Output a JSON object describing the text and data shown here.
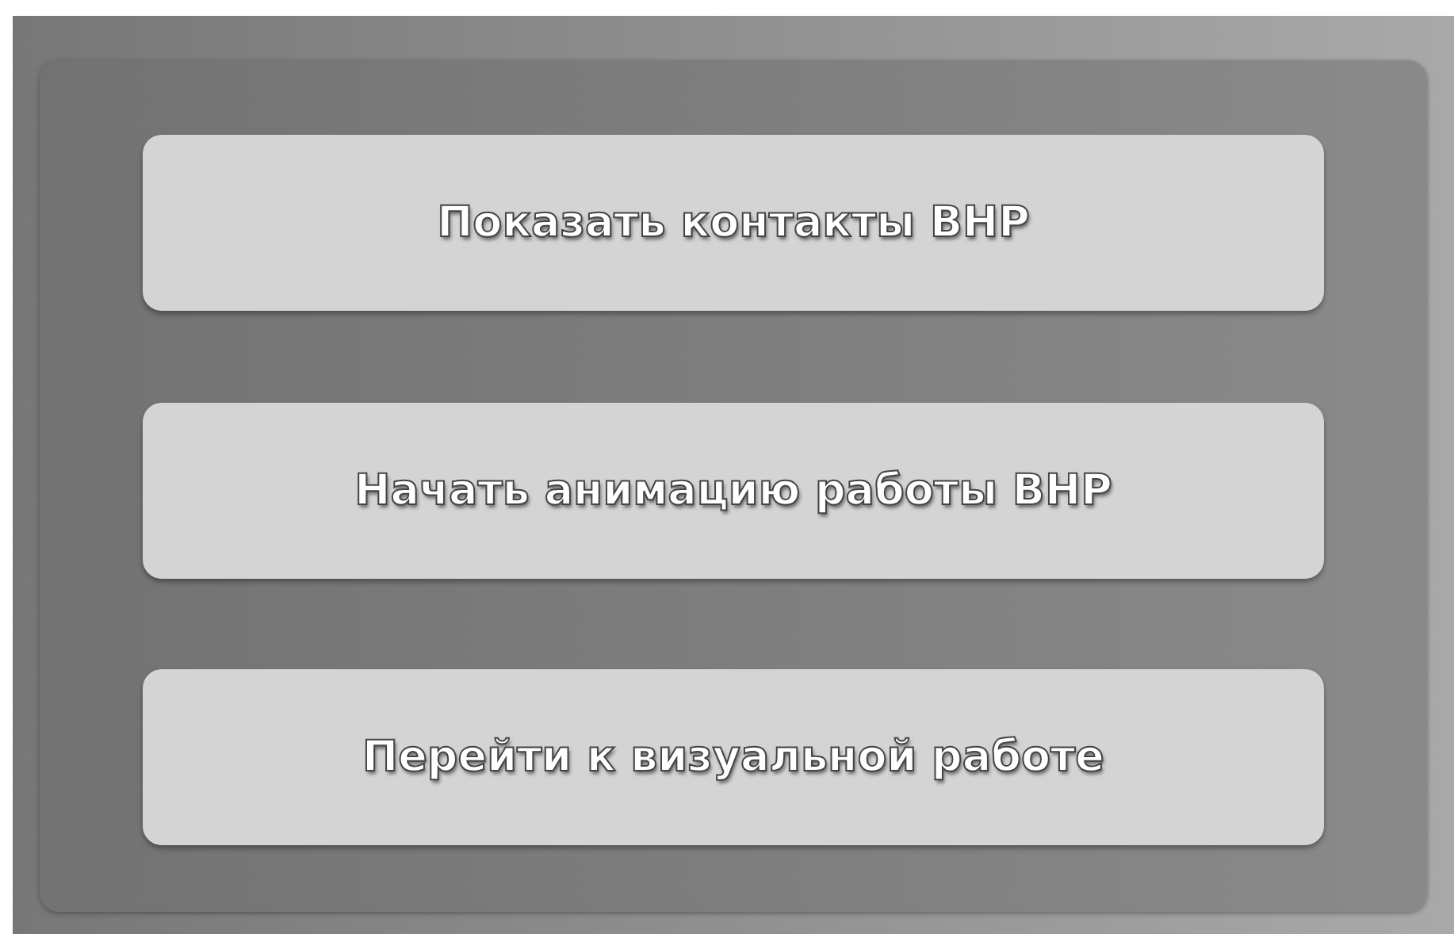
{
  "buttons": [
    {
      "label": "Показать контакты ВНР"
    },
    {
      "label": "Начать анимацию работы ВНР"
    },
    {
      "label": "Перейти к визуальной работе"
    }
  ]
}
